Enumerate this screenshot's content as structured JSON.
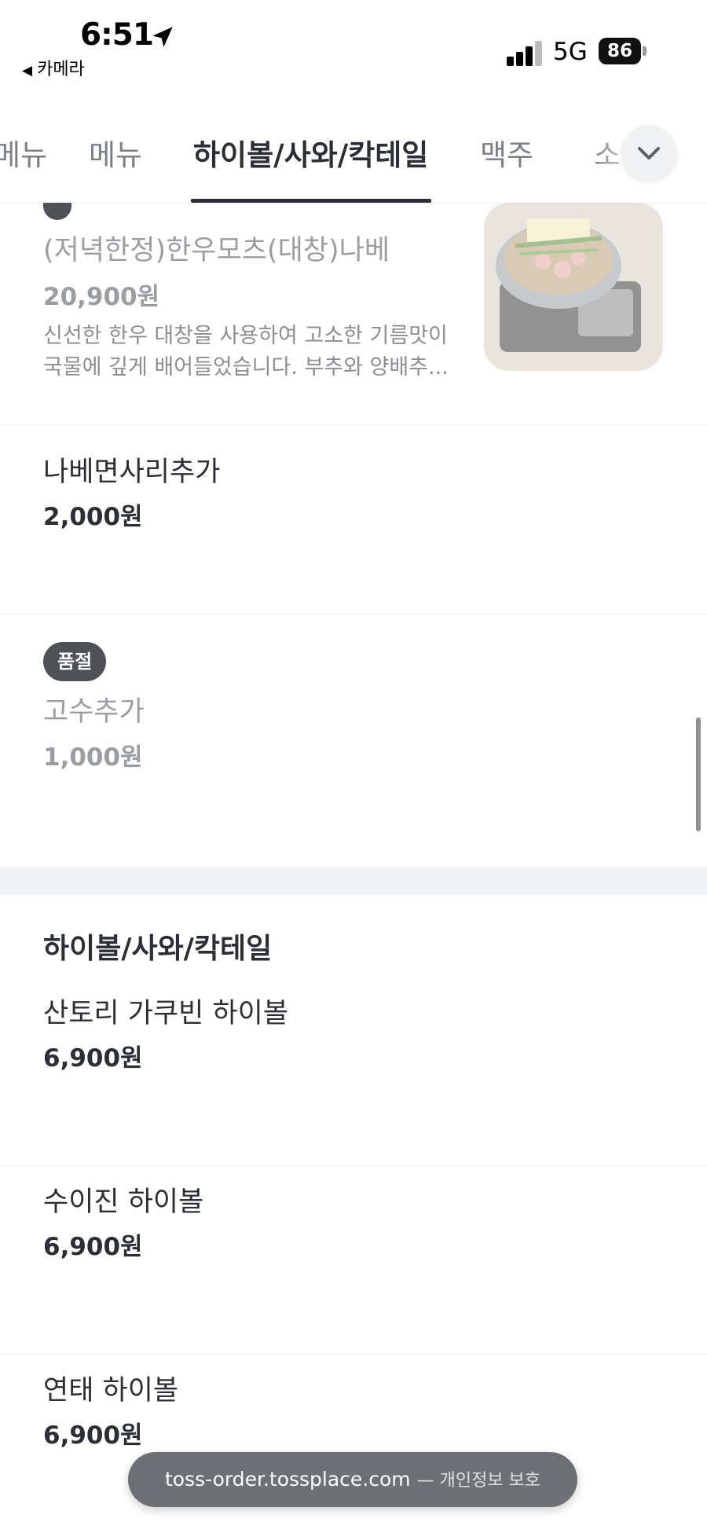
{
  "status_bar": {
    "time": "6:51",
    "back_app": "카메라",
    "network": "5G",
    "battery": "86",
    "signal_bars": 3
  },
  "tabs": {
    "items": [
      {
        "label": "메뉴"
      },
      {
        "label": "메뉴"
      },
      {
        "label": "하이볼/사와/칵테일"
      },
      {
        "label": "맥주"
      },
      {
        "label": "소"
      }
    ],
    "active_index": 2
  },
  "menu": {
    "items": [
      {
        "name": "(저녁한정)한우모츠(대창)나베",
        "price": "20,900원",
        "description": "신선한 한우 대창을 사용하여 고소한 기름맛이 국물에 깊게 배어들었습니다. 부추와 양배추..."
      },
      {
        "name": "나베면사리추가",
        "price": "2,000원"
      },
      {
        "badge": "품절",
        "name": "고수추가",
        "price": "1,000원"
      }
    ]
  },
  "section": {
    "title": "하이볼/사와/칵테일",
    "items": [
      {
        "name": "산토리 가쿠빈 하이볼",
        "price": "6,900원"
      },
      {
        "name": "수이진 하이볼",
        "price": "6,900원"
      },
      {
        "name": "연태 하이볼",
        "price": "6,900원"
      }
    ]
  },
  "url_bar": {
    "domain": "toss-order.tossplace.com",
    "suffix": "— 개인정보 보호"
  },
  "colors": {
    "text": "#2b2f35",
    "muted": "#9a9da2",
    "badge": "#4e5156",
    "section_gap": "#f2f3f5"
  }
}
